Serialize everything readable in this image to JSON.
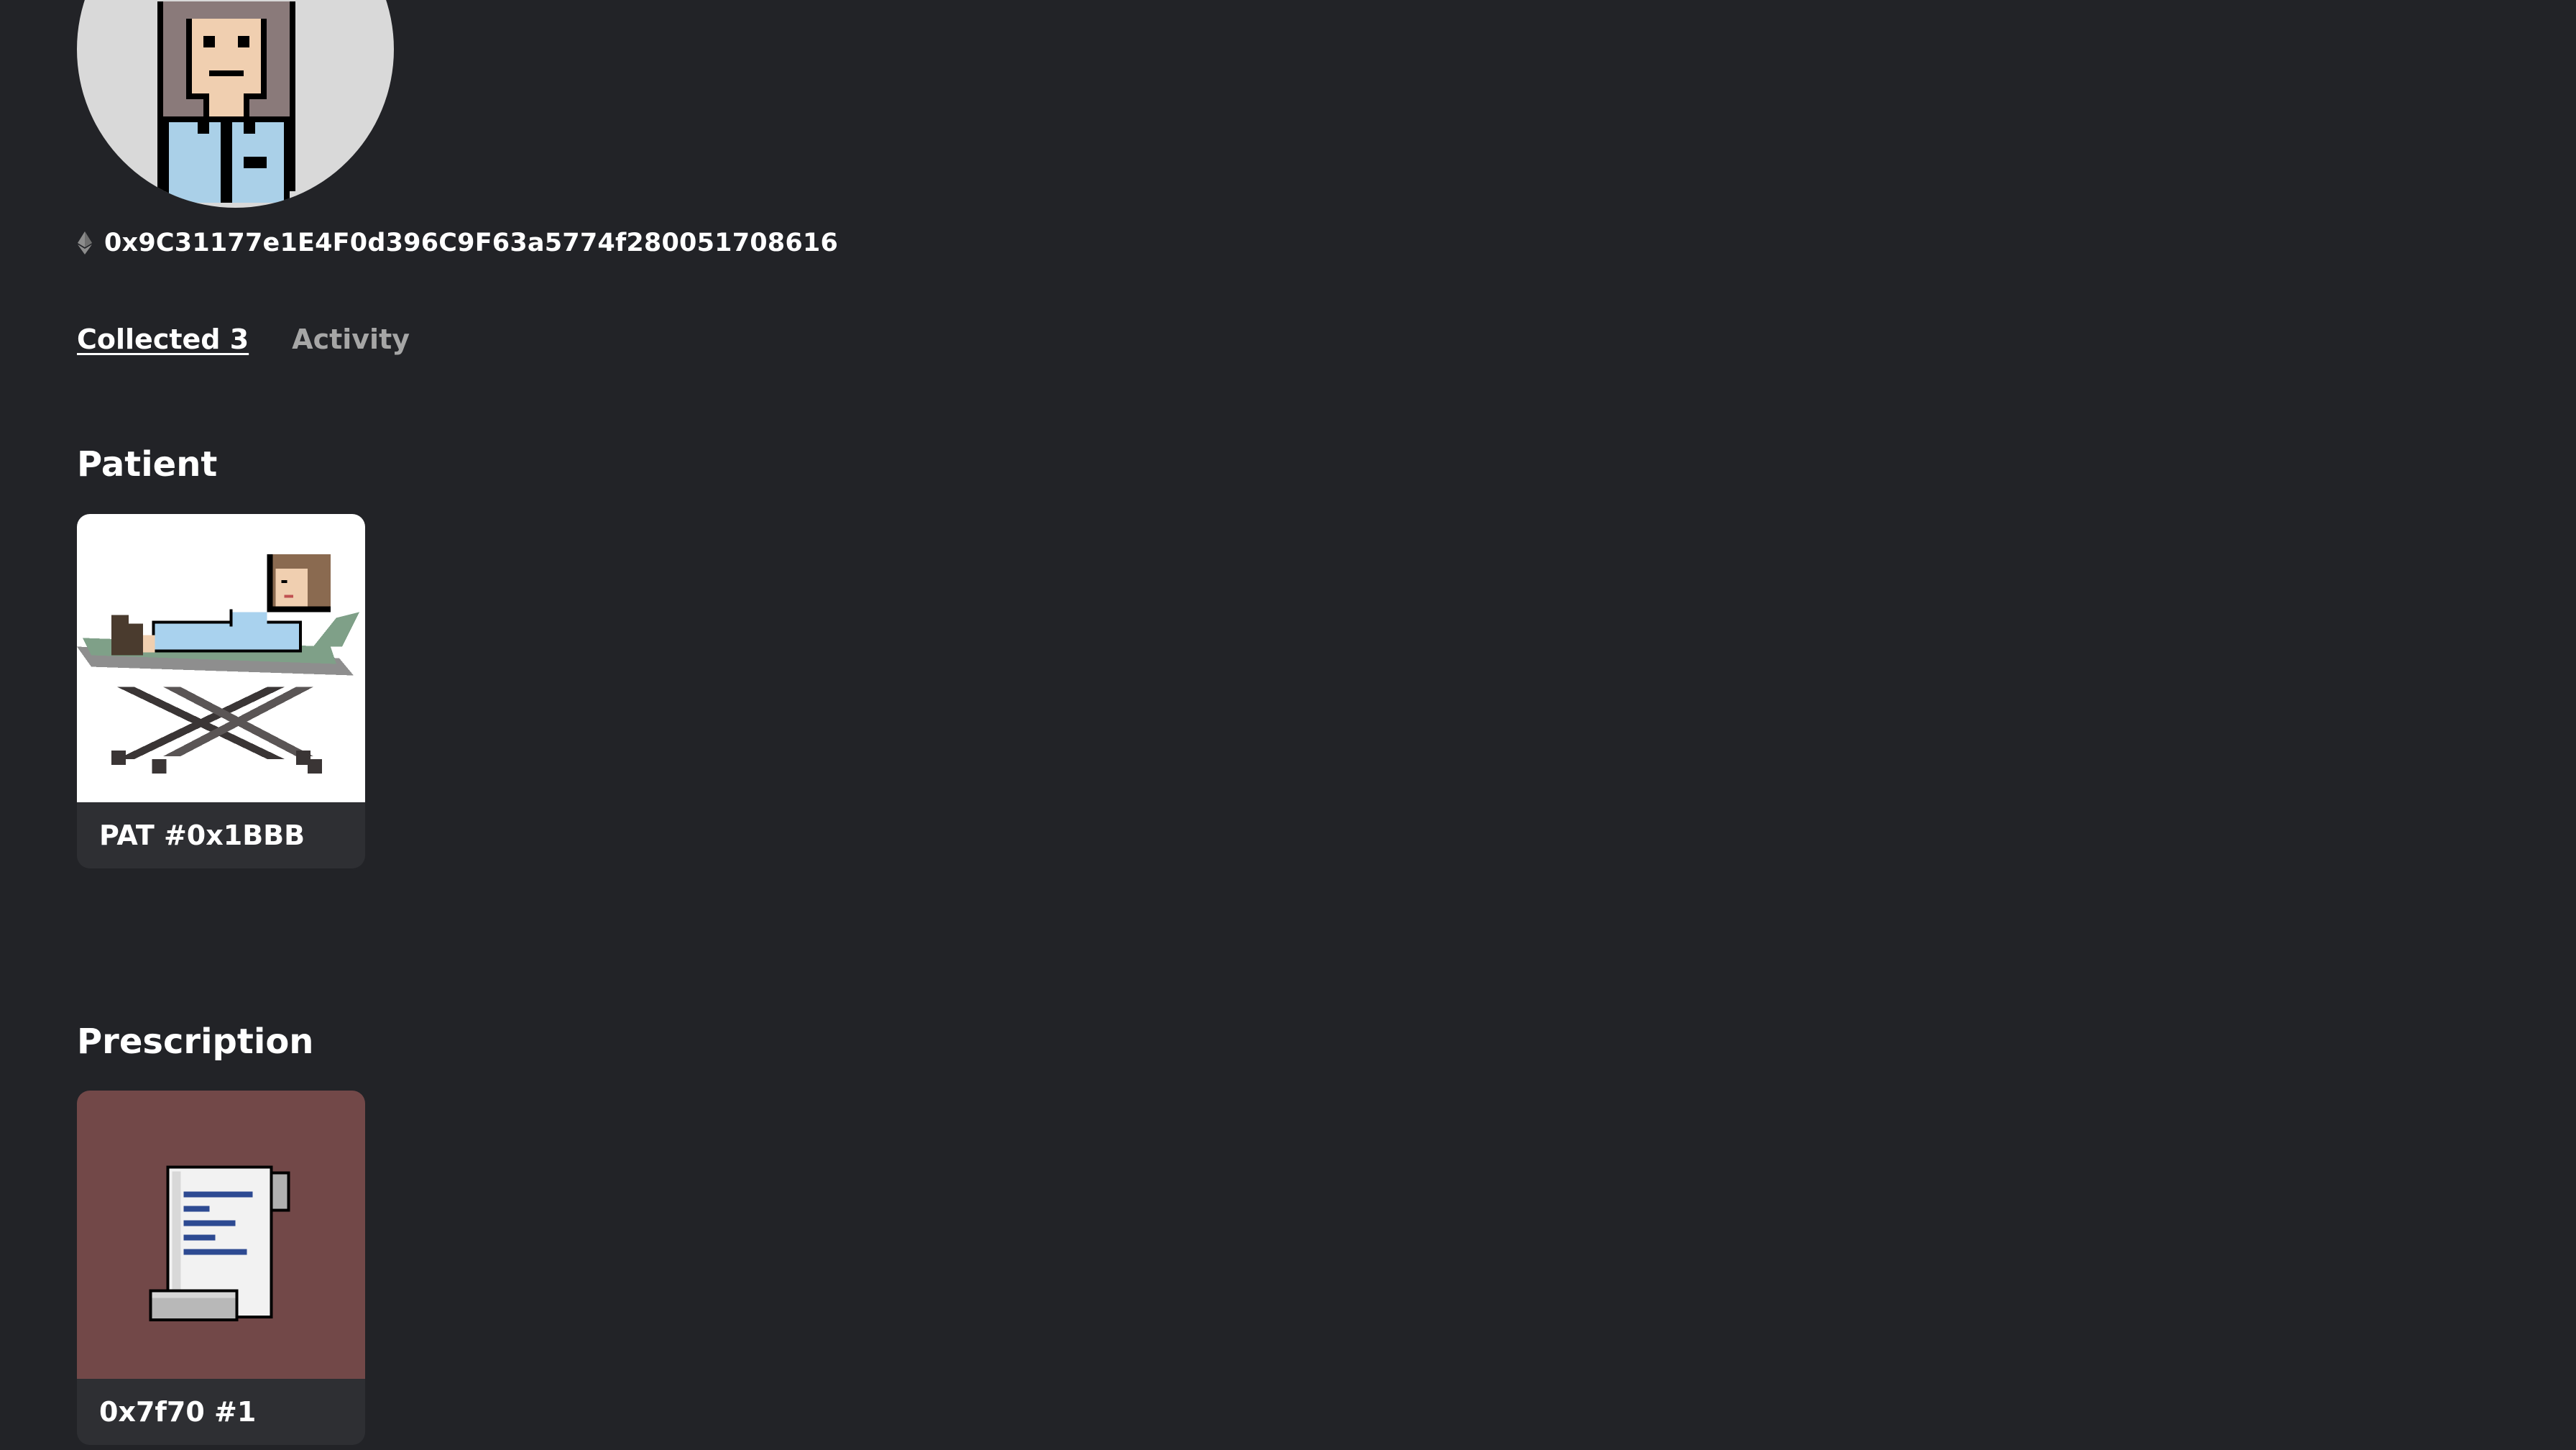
{
  "profile": {
    "address": "0x9C31177e1E4F0d396C9F63a5774f280051708616",
    "avatar_icon": "pixel-doctor-avatar-icon",
    "address_icon": "ethereum-icon"
  },
  "tabs": [
    {
      "label": "Collected 3",
      "active": true
    },
    {
      "label": "Activity",
      "active": false
    }
  ],
  "sections": [
    {
      "title": "Patient",
      "items": [
        {
          "label": "PAT #0x1BBB",
          "art_icon": "patient-on-stretcher-icon",
          "bg_color": "#ffffff"
        }
      ]
    },
    {
      "title": "Prescription",
      "items": [
        {
          "label": "0x7f70 #1",
          "art_icon": "prescription-scroll-icon",
          "bg_color": "#724848"
        }
      ]
    }
  ]
}
